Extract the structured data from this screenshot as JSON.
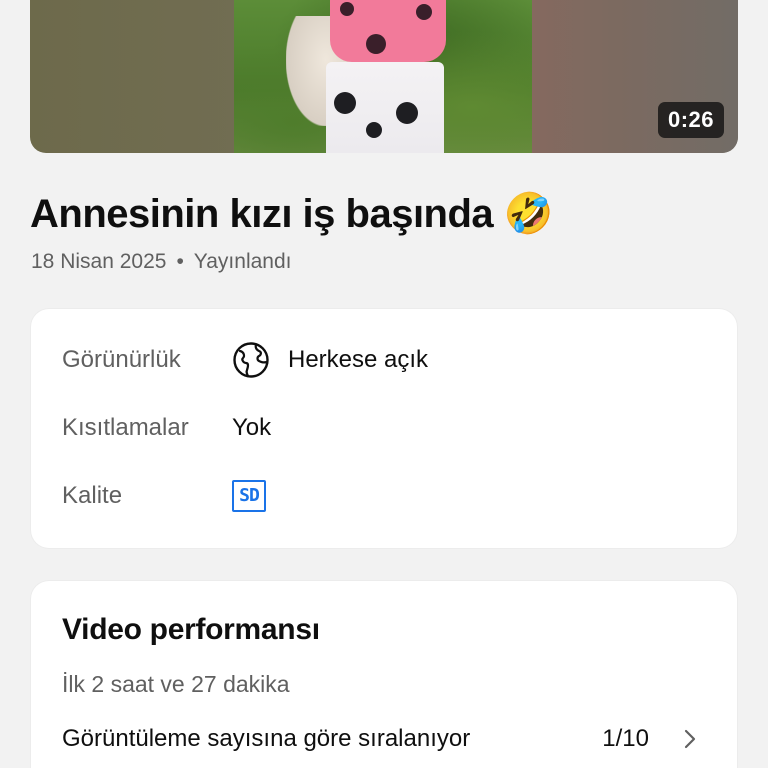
{
  "video": {
    "duration": "0:26",
    "title": "Annesinin kızı iş başında",
    "title_emoji": "🤣",
    "date": "18 Nisan 2025",
    "separator": "•",
    "status": "Yayınlandı"
  },
  "details": {
    "visibility_label": "Görünürlük",
    "visibility_value": "Herkese açık",
    "visibility_icon": "globe-icon",
    "restrictions_label": "Kısıtlamalar",
    "restrictions_value": "Yok",
    "quality_label": "Kalite",
    "quality_badge": "SD",
    "quality_color": "#1a73e8"
  },
  "performance": {
    "title": "Video performansı",
    "subtitle": "İlk 2 saat ve 27 dakika",
    "ranking_label": "Görüntüleme sayısına göre sıralanıyor",
    "ranking_value": "1/10",
    "chevron_icon": "chevron-right-icon"
  }
}
